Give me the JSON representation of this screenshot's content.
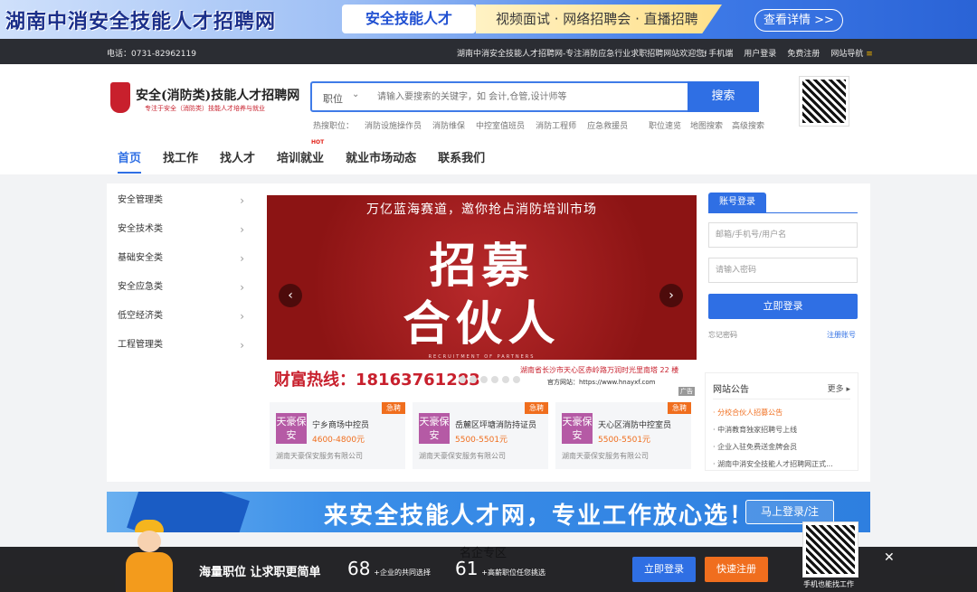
{
  "top_banner": {
    "title": "湖南中消安全技能人才招聘网",
    "pill": "安全技能人才",
    "slogan": "视频面试 · 网络招聘会 · 直播招聘",
    "cta": "查看详情 >>"
  },
  "info_bar": {
    "phone": "电话：0731-82962119",
    "welcome": "湖南中消安全技能人才招聘网-专注消防应急行业求职招聘网站欢迎您!",
    "links": [
      "手机端",
      "用户登录",
      "免费注册",
      "网站导航"
    ]
  },
  "logo": {
    "title": "安全(消防类)技能人才招聘网",
    "subtitle": "专注于安全（消防类）技能人才培养与就业"
  },
  "search": {
    "category": "职位",
    "placeholder": "请输入要搜索的关键字，如 会计,仓管,设计师等",
    "button": "搜索",
    "hot_label": "热搜职位：",
    "hot_terms": [
      "消防设施操作员",
      "消防维保",
      "中控室值班员",
      "消防工程师",
      "应急救援员"
    ],
    "links": [
      "职位速览",
      "地图搜索",
      "高级搜索"
    ]
  },
  "nav": {
    "items": [
      "首页",
      "找工作",
      "找人才",
      "培训就业",
      "就业市场动态",
      "联系我们"
    ],
    "hot_tag": "HOT"
  },
  "sidebar": {
    "items": [
      "安全管理类",
      "安全技术类",
      "基础安全类",
      "安全应急类",
      "低空经济类",
      "工程管理类"
    ]
  },
  "banner": {
    "line1": "万亿蓝海赛道，邀你抢占消防培训市场",
    "line2": "招募",
    "line3": "合伙人",
    "line4": "RECRUITMENT OF PARTNERS",
    "hotline": "财富热线：18163761283",
    "address": "湖南省长沙市天心区赤岭路万润时光里南塔 22 楼",
    "website": "官方网站：https://www.hnayxf.com",
    "ad_tag": "广告"
  },
  "jobs": [
    {
      "logo": "天豪保安",
      "urgent": "急聘",
      "name": "宁乡商场中控员",
      "salary": "4600-4800元",
      "company": "湖南天豪保安服务有限公司"
    },
    {
      "logo": "天豪保安",
      "urgent": "急聘",
      "name": "岳麓区坪塘消防持证员",
      "salary": "5500-5501元",
      "company": "湖南天豪保安服务有限公司"
    },
    {
      "logo": "天豪保安",
      "urgent": "急聘",
      "name": "天心区消防中控室员",
      "salary": "5500-5501元",
      "company": "湖南天豪保安服务有限公司"
    }
  ],
  "login": {
    "tab": "账号登录",
    "account_placeholder": "邮箱/手机号/用户名",
    "password_placeholder": "请输入密码",
    "button": "立即登录",
    "forgot": "忘记密码",
    "register": "注册账号"
  },
  "notice": {
    "title": "网站公告",
    "more": "更多",
    "items": [
      "分校合伙人招募公告",
      "中消教育独家招聘号上线",
      "企业入驻免费送金牌会员",
      "湖南中消安全技能人才招聘网正式..."
    ]
  },
  "wide_ad": {
    "text": "来安全技能人才网，专业工作放心选！",
    "button": "马上登录/注"
  },
  "floating": {
    "title": "名企专区"
  },
  "bottom_bar": {
    "title": "海量职位 让求职更简单",
    "count1": "68",
    "count1_label": "+企业的共同选择",
    "count2": "61",
    "count2_label": "+高薪职位任您挑选",
    "login": "立即登录",
    "register": "快速注册",
    "qr_label": "手机也能找工作"
  },
  "colors": {
    "accent": "#2f6fe4",
    "urgent": "#f06e1e",
    "brand_red": "#c8202d"
  }
}
